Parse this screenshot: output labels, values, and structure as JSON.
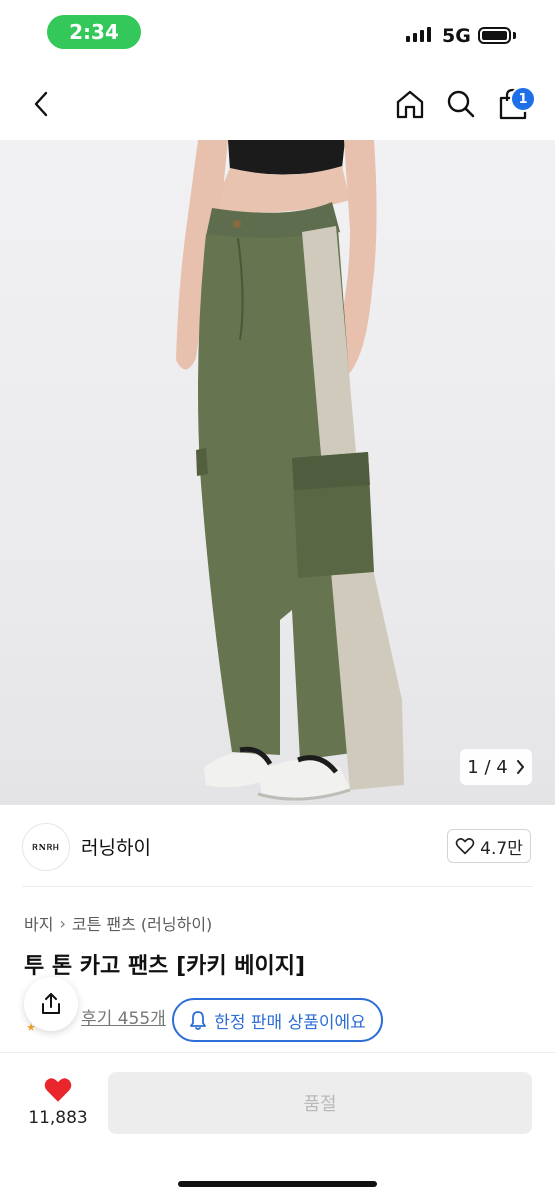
{
  "status_bar": {
    "time": "2:34",
    "network": "5G"
  },
  "header": {
    "back_icon": "chevron-left-icon",
    "home_icon": "home-icon",
    "search_icon": "search-icon",
    "cart_icon": "shopping-bag-icon",
    "cart_count": "1"
  },
  "gallery": {
    "current": "1",
    "separator": "/",
    "total": "4",
    "counter_text": "1 / 4"
  },
  "brand": {
    "logo_text": "ᏒNᏒᎻ",
    "name": "러닝하이",
    "likes": "4.7만"
  },
  "breadcrumb": {
    "category": "바지",
    "subcategory": "코튼 팬츠 (러닝하이)"
  },
  "product": {
    "title": "투 톤 카고 팬츠 [카키 베이지]"
  },
  "reviews": {
    "label": "후기 455개"
  },
  "limited_badge": {
    "text": "한정 판매 상품이에요"
  },
  "bottom_bar": {
    "wish_count": "11,883",
    "purchase_button": "품절"
  },
  "colors": {
    "accent": "#2d6ed6",
    "heart": "#e8262b",
    "status_pill": "#34c759",
    "badge": "#1e6fe8"
  }
}
